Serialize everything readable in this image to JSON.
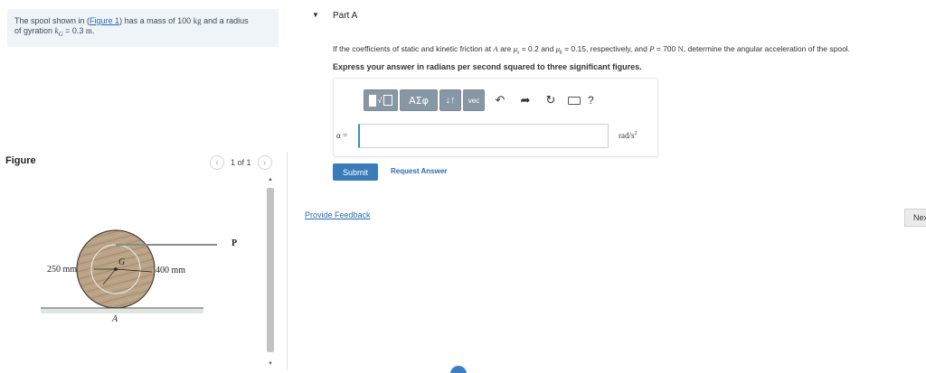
{
  "statement": {
    "text_before_link": "The spool shown in (",
    "link": "Figure 1",
    "text_after_link": ") has a mass of 100 ",
    "mass_unit": "kg",
    "text_radius": " and a radius",
    "line2_prefix": "of gyration ",
    "kg_symbol": "k",
    "kg_subscript": "G",
    "line2_value": " = 0.3 ",
    "line2_unit": "m",
    "line2_end": "."
  },
  "figure_panel": {
    "label": "Figure",
    "pager_text": "1 of 1",
    "prev_icon": "chevron-left-icon",
    "next_icon": "chevron-right-icon"
  },
  "figure": {
    "inner_radius_label": "250 mm",
    "outer_radius_label": "400 mm",
    "center_label": "G",
    "contact_label": "A",
    "force_label": "P"
  },
  "part": {
    "toggle_icon": "caret-down-icon",
    "title": "Part A"
  },
  "question": {
    "t1": "If the coefficients of static and kinetic friction at ",
    "A": "A",
    "t2": " are ",
    "mus": "μ",
    "mus_sub": "s",
    "t3": " = 0.2 and ",
    "muk": "μ",
    "muk_sub": "k",
    "t4": " = 0.15, respectively, and ",
    "P": "P",
    "t5": " = 700 ",
    "N": "N",
    "t6": ", determine the angular acceleration of the spool."
  },
  "instruction": "Express your answer in radians per second squared to three significant figures.",
  "toolbar": {
    "greek_label": "ΑΣφ",
    "arrows_label": "↓↑",
    "vec_label": "vec",
    "undo_icon": "undo-icon",
    "redo_icon": "redo-icon",
    "reset_icon": "reset-icon",
    "keyboard_icon": "keyboard-icon",
    "help_label": "?"
  },
  "answer": {
    "variable_label": "α =",
    "value": "",
    "unit": "rad/s",
    "unit_exp": "2"
  },
  "buttons": {
    "submit": "Submit",
    "request_answer": "Request Answer",
    "provide_feedback": "Provide Feedback",
    "next": "Next"
  }
}
